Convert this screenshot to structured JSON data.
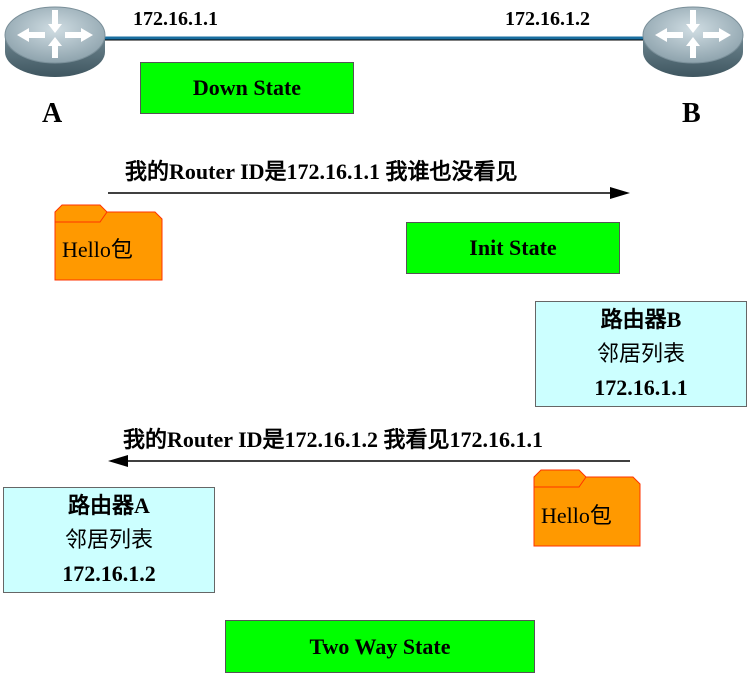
{
  "routers": [
    {
      "label": "A",
      "ip": "172.16.1.1",
      "icon": "router-icon"
    },
    {
      "label": "B",
      "ip": "172.16.1.2",
      "icon": "router-icon"
    }
  ],
  "states": {
    "down": "Down State",
    "init": "Init State",
    "two_way": "Two Way State"
  },
  "messages": [
    {
      "text": "我的Router ID是172.16.1.1 我谁也没看见",
      "direction": "A-to-B",
      "packet": "Hello包"
    },
    {
      "text": "我的Router ID是172.16.1.2 我看见172.16.1.1",
      "direction": "B-to-A",
      "packet": "Hello包"
    }
  ],
  "neighbor_tables": [
    {
      "title": "路由器B",
      "subtitle": "邻居列表",
      "entry": "172.16.1.1"
    },
    {
      "title": "路由器A",
      "subtitle": "邻居列表",
      "entry": "172.16.1.2"
    }
  ],
  "colors": {
    "state": "#00ff00",
    "neighbor_table": "#ccffff",
    "packet": "#ff9900",
    "link": "#1a6fa0"
  }
}
